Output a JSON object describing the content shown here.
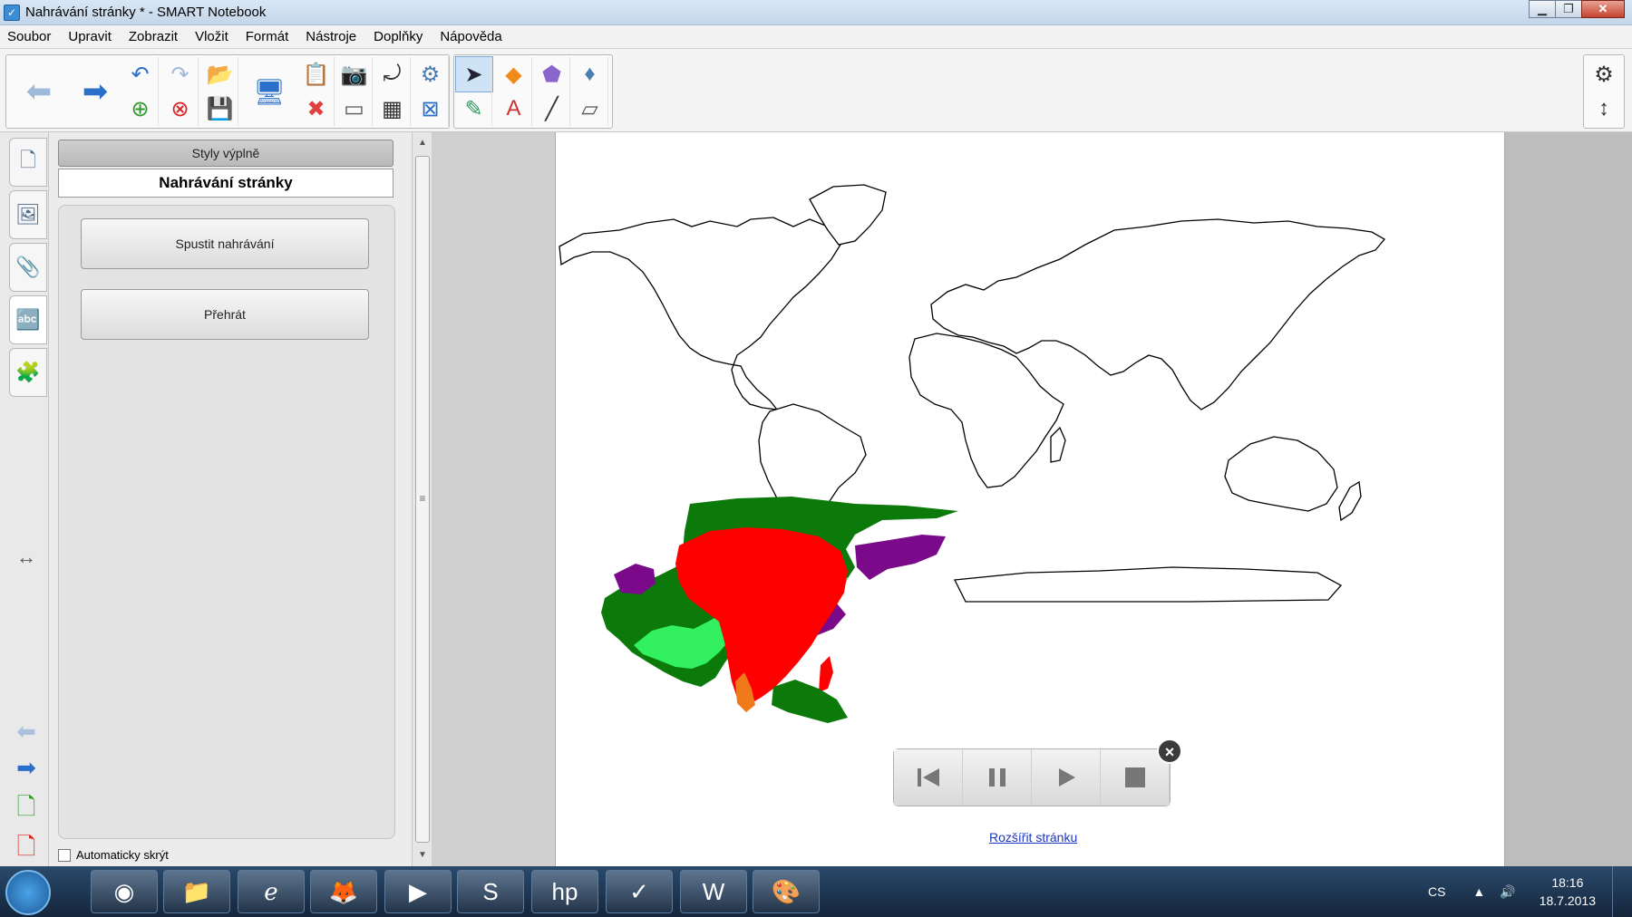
{
  "window": {
    "title": "Nahrávání stránky * - SMART Notebook",
    "minimize": "▁",
    "restore": "❐",
    "close": "✕"
  },
  "menu": [
    "Soubor",
    "Upravit",
    "Zobrazit",
    "Vložit",
    "Formát",
    "Nástroje",
    "Doplňky",
    "Nápověda"
  ],
  "panel": {
    "fill_styles_label": "Styly výplně",
    "heading": "Nahrávání stránky",
    "start_recording": "Spustit nahrávání",
    "play": "Přehrát",
    "autohide_label": "Automaticky skrýt"
  },
  "workspace": {
    "expand_page_link": "Rozšířit stránku"
  },
  "taskbar": {
    "language": "CS",
    "time": "18:16",
    "date": "18.7.2013"
  },
  "colors": {
    "africa_fill": "#ff0000",
    "dark_green": "#0b7a0b",
    "light_green": "#33f060",
    "purple": "#7a0a8a",
    "orange": "#f07a1a",
    "taskbar": "#1e3550"
  }
}
